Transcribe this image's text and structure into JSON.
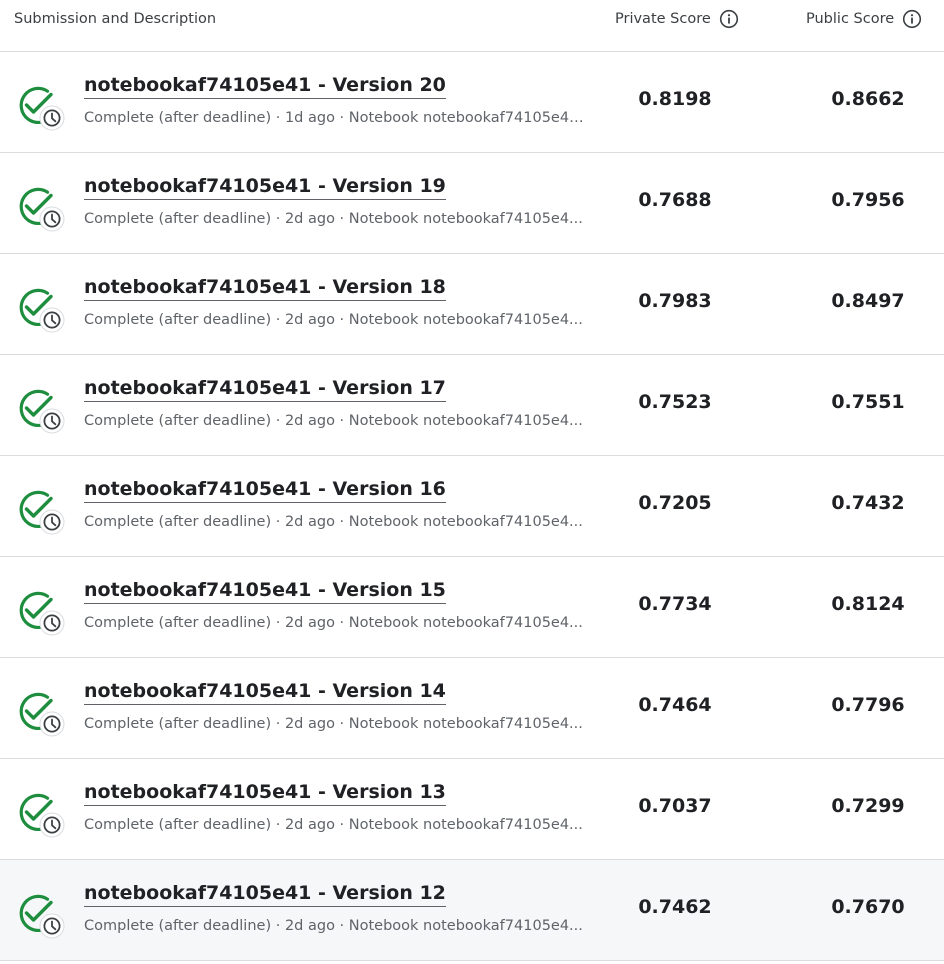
{
  "header": {
    "submission_label": "Submission and Description",
    "private_label": "Private Score",
    "public_label": "Public Score"
  },
  "colors": {
    "success_green": "#1e8e3e",
    "icon_gray": "#3c4043"
  },
  "rows": [
    {
      "title": "notebookaf74105e41 - Version 20",
      "status": "Complete (after deadline)",
      "age": "1d ago",
      "notebook": "Notebook notebookaf74105e41...",
      "private": "0.8198",
      "public": "0.8662"
    },
    {
      "title": "notebookaf74105e41 - Version 19",
      "status": "Complete (after deadline)",
      "age": "2d ago",
      "notebook": "Notebook notebookaf74105e4...",
      "private": "0.7688",
      "public": "0.7956"
    },
    {
      "title": "notebookaf74105e41 - Version 18",
      "status": "Complete (after deadline)",
      "age": "2d ago",
      "notebook": "Notebook notebookaf74105e4...",
      "private": "0.7983",
      "public": "0.8497"
    },
    {
      "title": "notebookaf74105e41 - Version 17",
      "status": "Complete (after deadline)",
      "age": "2d ago",
      "notebook": "Notebook notebookaf74105e4...",
      "private": "0.7523",
      "public": "0.7551"
    },
    {
      "title": "notebookaf74105e41 - Version 16",
      "status": "Complete (after deadline)",
      "age": "2d ago",
      "notebook": "Notebook notebookaf74105e4...",
      "private": "0.7205",
      "public": "0.7432"
    },
    {
      "title": "notebookaf74105e41 - Version 15",
      "status": "Complete (after deadline)",
      "age": "2d ago",
      "notebook": "Notebook notebookaf74105e4...",
      "private": "0.7734",
      "public": "0.8124"
    },
    {
      "title": "notebookaf74105e41 - Version 14",
      "status": "Complete (after deadline)",
      "age": "2d ago",
      "notebook": "Notebook notebookaf74105e4...",
      "private": "0.7464",
      "public": "0.7796"
    },
    {
      "title": "notebookaf74105e41 - Version 13",
      "status": "Complete (after deadline)",
      "age": "2d ago",
      "notebook": "Notebook notebookaf74105e4...",
      "private": "0.7037",
      "public": "0.7299"
    },
    {
      "title": "notebookaf74105e41 - Version 12",
      "status": "Complete (after deadline)",
      "age": "2d ago",
      "notebook": "Notebook notebookaf74105e4...",
      "private": "0.7462",
      "public": "0.7670"
    }
  ]
}
